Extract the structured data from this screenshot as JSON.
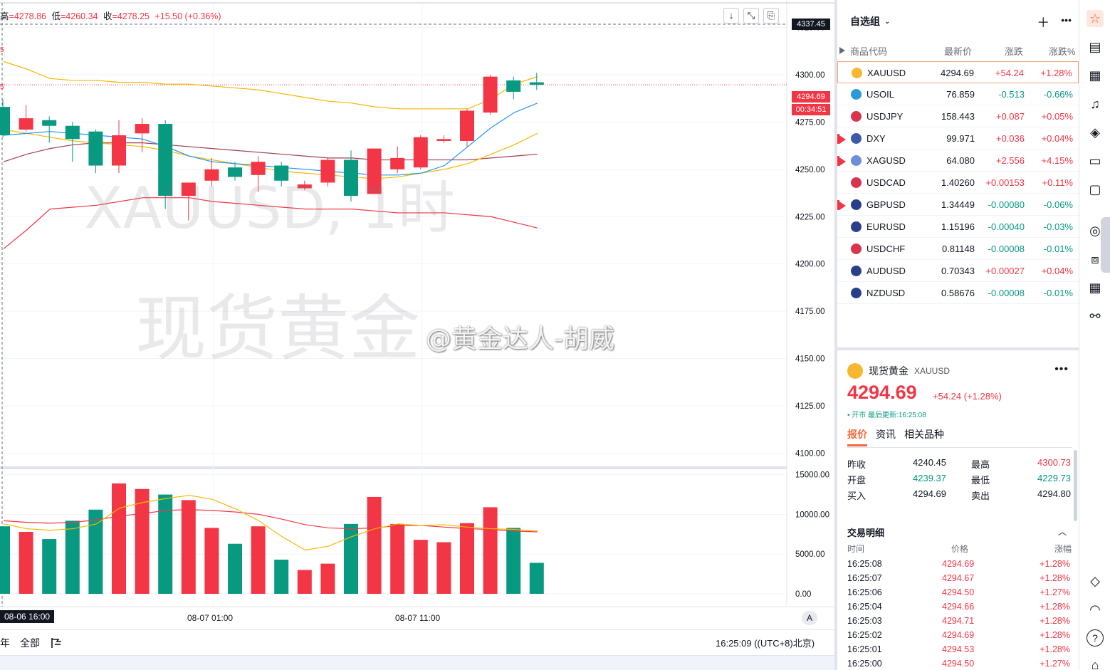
{
  "ohlc": {
    "high_label": "高",
    "high": "=4278.86",
    "low_label": "低",
    "low": "=4260.34",
    "close_label": "收",
    "close": "=4278.25",
    "change": "+15.50 (+0.36%)"
  },
  "chart": {
    "watermark_line1": "XAUUSD, 1时",
    "watermark_line2": "现货黄金",
    "credit_watermark": "@黄金达人-胡威",
    "price_ticks": [
      "4325.00",
      "4300.00",
      "4275.00",
      "4250.00",
      "4225.00",
      "4200.00",
      "4175.00",
      "4150.00",
      "4125.00",
      "4100.00"
    ],
    "volume_ticks": [
      "15000.00",
      "10000.00",
      "5000.00",
      "0.00"
    ],
    "crosshair_price": "4337.45",
    "last_price_tag": "4294.69",
    "countdown_tag": "00:34:51",
    "left_edge_marks": [
      "5",
      "5"
    ],
    "time_labels": {
      "cursor": "08-06  16:00",
      "t1": "08-07 01:00",
      "t2": "08-07 11:00"
    },
    "auto_button": "A",
    "bottom": {
      "range": "年",
      "all": "全部",
      "clock": "16:25:09 ((UTC+8)北京)"
    },
    "colors": {
      "up": "#f23645",
      "down": "#089981",
      "ma_orange": "#f5b800",
      "ma_blue": "#2196f3",
      "ma_red": "#f23645",
      "ma_maroon": "#a04050"
    }
  },
  "chart_data": {
    "type": "candlestick",
    "title": "XAUUSD, 1时",
    "x_labels": [
      "08-06 16:00",
      "08-07 01:00",
      "08-07 11:00"
    ],
    "ylim": [
      4093,
      4338
    ],
    "candles": [
      {
        "o": 4283,
        "h": 4287,
        "l": 4267,
        "c": 4268
      },
      {
        "o": 4271,
        "h": 4284,
        "l": 4270,
        "c": 4277
      },
      {
        "o": 4276,
        "h": 4278,
        "l": 4264,
        "c": 4273
      },
      {
        "o": 4273,
        "h": 4275,
        "l": 4254,
        "c": 4266
      },
      {
        "o": 4270,
        "h": 4271,
        "l": 4248,
        "c": 4252
      },
      {
        "o": 4252,
        "h": 4276,
        "l": 4248,
        "c": 4268
      },
      {
        "o": 4269,
        "h": 4277,
        "l": 4259,
        "c": 4274
      },
      {
        "o": 4274,
        "h": 4276,
        "l": 4229,
        "c": 4236
      },
      {
        "o": 4236,
        "h": 4240,
        "l": 4223,
        "c": 4243
      },
      {
        "o": 4244,
        "h": 4256,
        "l": 4241,
        "c": 4250
      },
      {
        "o": 4251,
        "h": 4254,
        "l": 4244,
        "c": 4246
      },
      {
        "o": 4247,
        "h": 4257,
        "l": 4238,
        "c": 4254
      },
      {
        "o": 4252,
        "h": 4254,
        "l": 4241,
        "c": 4244
      },
      {
        "o": 4240,
        "h": 4244,
        "l": 4239,
        "c": 4242
      },
      {
        "o": 4243,
        "h": 4256,
        "l": 4241,
        "c": 4255
      },
      {
        "o": 4255,
        "h": 4260,
        "l": 4233,
        "c": 4236
      },
      {
        "o": 4237,
        "h": 4261,
        "l": 4237,
        "c": 4261
      },
      {
        "o": 4250,
        "h": 4262,
        "l": 4248,
        "c": 4256
      },
      {
        "o": 4251,
        "h": 4268,
        "l": 4250,
        "c": 4267
      },
      {
        "o": 4265,
        "h": 4268,
        "l": 4264,
        "c": 4266
      },
      {
        "o": 4265,
        "h": 4282,
        "l": 4262,
        "c": 4281
      },
      {
        "o": 4280,
        "h": 4300,
        "l": 4279,
        "c": 4299
      },
      {
        "o": 4297,
        "h": 4299,
        "l": 4287,
        "c": 4291
      },
      {
        "o": 4296,
        "h": 4301,
        "l": 4292,
        "c": 4294.69
      }
    ],
    "volumes": [
      8500,
      7800,
      6900,
      9200,
      10600,
      13900,
      13200,
      12500,
      11800,
      8300,
      6300,
      8500,
      4300,
      3000,
      3800,
      8800,
      12200,
      8800,
      6800,
      6500,
      8900,
      10900,
      8300,
      3900
    ],
    "ma_price": {
      "orange_upper": [
        4307,
        4303,
        4298,
        4297,
        4297,
        4296,
        4296,
        4295,
        4295,
        4294,
        4293,
        4292,
        4290,
        4288,
        4286,
        4285,
        4283,
        4282,
        4282,
        4282,
        4282,
        4287,
        4295,
        4299
      ],
      "blue": [
        4268,
        4269,
        4270,
        4269,
        4268,
        4267,
        4266,
        4262,
        4257,
        4254,
        4253,
        4252,
        4251,
        4250,
        4249,
        4248,
        4247,
        4247,
        4248,
        4252,
        4262,
        4272,
        4280,
        4285
      ],
      "orange_lower": [
        4271,
        4269,
        4267,
        4265,
        4264,
        4263,
        4262,
        4260,
        4257,
        4255,
        4253,
        4251,
        4249,
        4248,
        4247,
        4246,
        4245,
        4246,
        4248,
        4250,
        4253,
        4258,
        4263,
        4269
      ],
      "maroon": [
        4254,
        4258,
        4261,
        4263,
        4264,
        4264,
        4264,
        4263,
        4262,
        4261,
        4260,
        4259,
        4258,
        4257,
        4256,
        4256,
        4255,
        4255,
        4255,
        4255,
        4255,
        4256,
        4257,
        4258
      ],
      "red": [
        4208,
        4218,
        4229,
        4230,
        4231,
        4233,
        4235,
        4235,
        4235,
        4233,
        4232,
        4231,
        4230,
        4229,
        4229,
        4229,
        4228,
        4227,
        4227,
        4227,
        4226,
        4225,
        4222,
        4219
      ]
    },
    "ma_volume": {
      "orange": [
        8800,
        8200,
        8000,
        8200,
        8800,
        10800,
        11500,
        12000,
        12400,
        11900,
        10700,
        9200,
        7200,
        5500,
        6000,
        7200,
        8200,
        8800,
        8600,
        8700,
        8400,
        8200,
        8100,
        7900
      ],
      "red": [
        9200,
        9000,
        8900,
        9000,
        9300,
        9800,
        10100,
        10500,
        10600,
        10500,
        10300,
        10000,
        9400,
        8700,
        8300,
        8200,
        8300,
        8600,
        8600,
        8400,
        8200,
        8100,
        7900,
        7800
      ]
    }
  },
  "watchlist": {
    "title": "自选组",
    "columns": {
      "symbol": "商品代码",
      "last": "最新价",
      "change": "涨跌",
      "pct": "涨跌%"
    },
    "rows": [
      {
        "sym": "XAUUSD",
        "last": "4294.69",
        "chg": "+54.24",
        "pct": "+1.28%",
        "dir": "up",
        "icon": "#f5b82e",
        "flag": "none",
        "selected": true
      },
      {
        "sym": "USOIL",
        "last": "76.859",
        "chg": "-0.513",
        "pct": "-0.66%",
        "dir": "down",
        "icon": "#2a9bd8",
        "flag": "none"
      },
      {
        "sym": "USDJPY",
        "last": "158.443",
        "chg": "+0.087",
        "pct": "+0.05%",
        "dir": "up",
        "icon": "#d8344c",
        "flag": "none"
      },
      {
        "sym": "DXY",
        "last": "99.971",
        "chg": "+0.036",
        "pct": "+0.04%",
        "dir": "up",
        "icon": "#3c5aa8",
        "flag": "red"
      },
      {
        "sym": "XAGUSD",
        "last": "64.080",
        "chg": "+2.556",
        "pct": "+4.15%",
        "dir": "up",
        "icon": "#6d8fd8",
        "flag": "red"
      },
      {
        "sym": "USDCAD",
        "last": "1.40260",
        "chg": "+0.00153",
        "pct": "+0.11%",
        "dir": "up",
        "icon": "#d8344c",
        "flag": "none"
      },
      {
        "sym": "GBPUSD",
        "last": "1.34449",
        "chg": "-0.00080",
        "pct": "-0.06%",
        "dir": "down",
        "icon": "#2a3f8a",
        "flag": "red"
      },
      {
        "sym": "EURUSD",
        "last": "1.15196",
        "chg": "-0.00040",
        "pct": "-0.03%",
        "dir": "down",
        "icon": "#2a3f8a",
        "flag": "none"
      },
      {
        "sym": "USDCHF",
        "last": "0.81148",
        "chg": "-0.00008",
        "pct": "-0.01%",
        "dir": "down",
        "icon": "#d8344c",
        "flag": "none"
      },
      {
        "sym": "AUDUSD",
        "last": "0.70343",
        "chg": "+0.00027",
        "pct": "+0.04%",
        "dir": "up",
        "icon": "#2a3f8a",
        "flag": "none"
      },
      {
        "sym": "NZDUSD",
        "last": "0.58676",
        "chg": "-0.00008",
        "pct": "-0.01%",
        "dir": "down",
        "icon": "#2a3f8a",
        "flag": "none"
      }
    ]
  },
  "detail": {
    "name": "现货黄金",
    "symbol": "XAUUSD",
    "price": "4294.69",
    "change": "+54.24 (+1.28%)",
    "status": "• 开市  最后更新:16:25:08",
    "tabs": [
      "报价",
      "资讯",
      "相关品种"
    ],
    "quote": {
      "prev_close_label": "昨收",
      "prev_close": "4240.45",
      "high_label": "最高",
      "high": "4300.73",
      "open_label": "开盘",
      "open": "4239.37",
      "low_label": "最低",
      "low": "4229.73",
      "bid_label": "买入",
      "bid": "4294.69",
      "ask_label": "卖出",
      "ask": "4294.80"
    },
    "trades_title": "交易明细",
    "trades_cols": {
      "time": "时间",
      "price": "价格",
      "pct": "涨幅"
    },
    "trades": [
      {
        "t": "16:25:08",
        "p": "4294.69",
        "pct": "+1.28%"
      },
      {
        "t": "16:25:07",
        "p": "4294.67",
        "pct": "+1.28%"
      },
      {
        "t": "16:25:06",
        "p": "4294.50",
        "pct": "+1.27%"
      },
      {
        "t": "16:25:04",
        "p": "4294.66",
        "pct": "+1.28%"
      },
      {
        "t": "16:25:03",
        "p": "4294.71",
        "pct": "+1.28%"
      },
      {
        "t": "16:25:02",
        "p": "4294.69",
        "pct": "+1.28%"
      },
      {
        "t": "16:25:01",
        "p": "4294.53",
        "pct": "+1.28%"
      },
      {
        "t": "16:25:00",
        "p": "4294.50",
        "pct": "+1.27%"
      }
    ]
  },
  "rail_icons": [
    "watchlist-icon",
    "news-icon",
    "calendar-icon",
    "alerts-icon",
    "layers-icon",
    "video-icon",
    "chat-icon",
    "target-icon",
    "education-icon",
    "table-icon",
    "stats-icon",
    "handshake-icon",
    "headset-icon",
    "help-icon"
  ]
}
